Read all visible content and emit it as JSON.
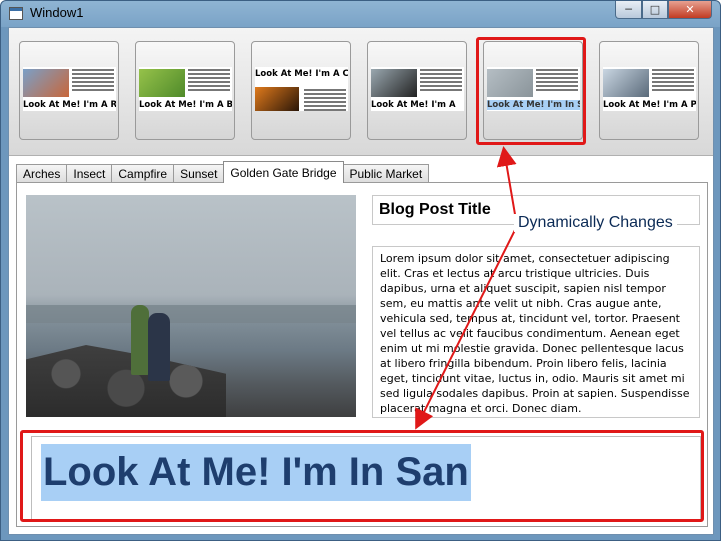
{
  "window": {
    "title": "Window1",
    "min": "─",
    "max": "□",
    "close": "✕"
  },
  "thumbnails": [
    {
      "caption": "Look At Me! I'm A Rock!",
      "colors": [
        "#c8663a",
        "#7aa0c8"
      ],
      "layout": "normal",
      "selected": false
    },
    {
      "caption": "Look At Me! I'm A Bug!",
      "colors": [
        "#4f8a2a",
        "#96c24a"
      ],
      "layout": "normal",
      "selected": false
    },
    {
      "caption": "Look At Me! I'm A Campfire!",
      "colors": [
        "#2a1608",
        "#e07a1c"
      ],
      "layout": "alt",
      "selected": false
    },
    {
      "caption": "Look At Me! I'm A",
      "colors": [
        "#222222",
        "#9aa8b0"
      ],
      "layout": "normal",
      "selected": false
    },
    {
      "caption": "Look At Me! I'm In San",
      "colors": [
        "#8a949a",
        "#b5bec4"
      ],
      "layout": "normal",
      "selected": true
    },
    {
      "caption": "Look At Me! I'm A Public",
      "colors": [
        "#5a6a7a",
        "#c9d6e2"
      ],
      "layout": "normal",
      "selected": false
    }
  ],
  "tabs": [
    {
      "label": "Arches",
      "active": false
    },
    {
      "label": "Insect",
      "active": false
    },
    {
      "label": "Campfire",
      "active": false
    },
    {
      "label": "Sunset",
      "active": false
    },
    {
      "label": "Golden Gate Bridge",
      "active": true
    },
    {
      "label": "Public Market",
      "active": false
    }
  ],
  "post": {
    "title": "Blog Post Title",
    "body": "Lorem ipsum dolor sit amet, consectetuer adipiscing elit. Cras et lectus at arcu tristique ultricies. Duis dapibus, urna et aliquet suscipit, sapien nisl tempor sem, eu mattis ante velit ut nibh. Cras augue ante, vehicula sed, tempus at, tincidunt vel, tortor. Praesent vel tellus ac velit faucibus condimentum. Aenean eget enim ut mi molestie gravida. Donec pellentesque lacus at libero fringilla bibendum. Proin libero felis, lacinia eget, tincidunt vitae, luctus in, odio. Mauris sit amet mi sed ligula sodales dapibus. Proin at sapien. Suspendisse placerat magna et orci. Donec diam.",
    "big_label": "Look At Me! I'm In San"
  },
  "annotation": {
    "text": "Dynamically Changes",
    "color": "#e01818"
  }
}
